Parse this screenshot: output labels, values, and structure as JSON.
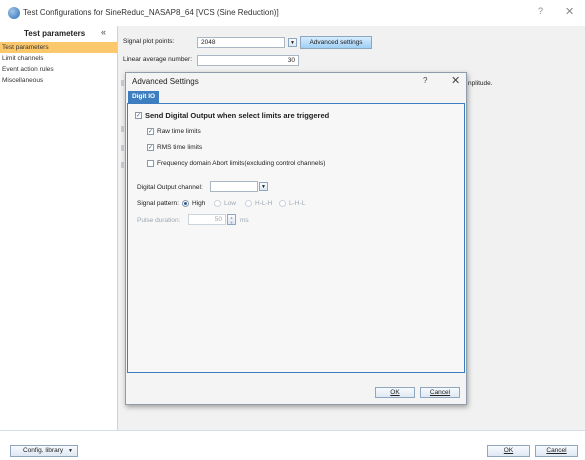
{
  "window": {
    "title": "Test Configurations for SineReduc_NASAP8_64 [VCS (Sine Reduction)]",
    "help": "?",
    "close": "✕"
  },
  "sidebar": {
    "header": "Test parameters",
    "collapse": "«",
    "items": [
      {
        "label": "Test parameters",
        "selected": true
      },
      {
        "label": "Limit channels",
        "selected": false
      },
      {
        "label": "Event action rules",
        "selected": false
      },
      {
        "label": "Miscellaneous",
        "selected": false
      }
    ]
  },
  "main": {
    "signal_plot_points_label": "Signal plot points:",
    "signal_plot_points_value": "2048",
    "advanced_settings_button": "Advanced settings",
    "linear_average_label": "Linear average number:",
    "linear_average_value": "30",
    "partial_text": "nplitude."
  },
  "dialog": {
    "title": "Advanced Settings",
    "help": "?",
    "close": "✕",
    "tab": "Digit IO",
    "send_digital_output": {
      "label": "Send Digital Output when select limits are triggered",
      "checked": true
    },
    "raw_time_limits": {
      "label": "Raw time limits",
      "checked": true
    },
    "rms_time_limits": {
      "label": "RMS time limits",
      "checked": true
    },
    "freq_abort_limits": {
      "label": "Frequency domain Abort limits(excluding control channels)",
      "checked": false
    },
    "digital_output_channel_label": "Digital Output channel:",
    "digital_output_channel_value": "",
    "signal_pattern_label": "Signal pattern:",
    "signal_patterns": [
      "High",
      "Low",
      "H-L-H",
      "L-H-L"
    ],
    "signal_pattern_selected": "High",
    "pulse_duration_label": "Pulse duration:",
    "pulse_duration_value": "50",
    "pulse_duration_unit": "ms",
    "ok_button": "OK",
    "cancel_button": "Cancel"
  },
  "bottom": {
    "config_library_button": "Config. library",
    "ok_button": "OK",
    "cancel_button": "Cancel"
  },
  "colors": {
    "selected_item": "#fbc86b",
    "tab_blue": "#3d7ec0"
  }
}
